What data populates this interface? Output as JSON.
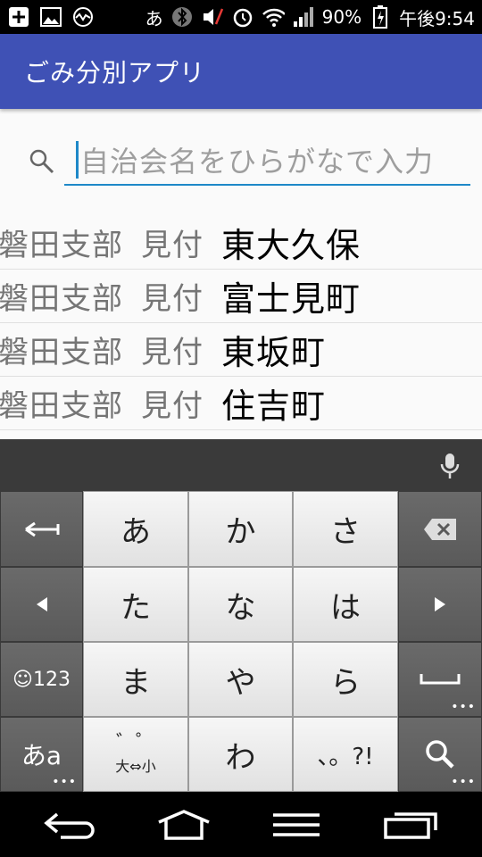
{
  "status_bar": {
    "ime_indicator": "あ",
    "battery_percent": "90%",
    "time": "午後9:54",
    "icons": [
      "plus-box-icon",
      "image-icon",
      "activity-icon",
      "bluetooth-icon",
      "mute-icon",
      "alarm-icon",
      "wifi-icon",
      "signal-icon",
      "battery-charging-icon"
    ]
  },
  "app_bar": {
    "title": "ごみ分別アプリ"
  },
  "search": {
    "placeholder": "自治会名をひらがなで入力",
    "icon": "search-icon"
  },
  "results": [
    {
      "branch": "磐田支部",
      "area": "見付",
      "town": "東大久保"
    },
    {
      "branch": "磐田支部",
      "area": "見付",
      "town": "富士見町"
    },
    {
      "branch": "磐田支部",
      "area": "見付",
      "town": "東坂町"
    },
    {
      "branch": "磐田支部",
      "area": "見付",
      "town": "住吉町"
    }
  ],
  "keyboard": {
    "row1": [
      "あ",
      "か",
      "さ"
    ],
    "row2": [
      "た",
      "な",
      "は"
    ],
    "row3": [
      "ま",
      "や",
      "ら"
    ],
    "row4": [
      "わ",
      "、。?!"
    ],
    "emoji_key": "☺123",
    "mode_key": "あa",
    "modifier_key_top": "゛゜",
    "modifier_key_bottom": "大⇔小"
  },
  "colors": {
    "app_bar": "#3f51b5",
    "accent": "#1e88c8"
  }
}
